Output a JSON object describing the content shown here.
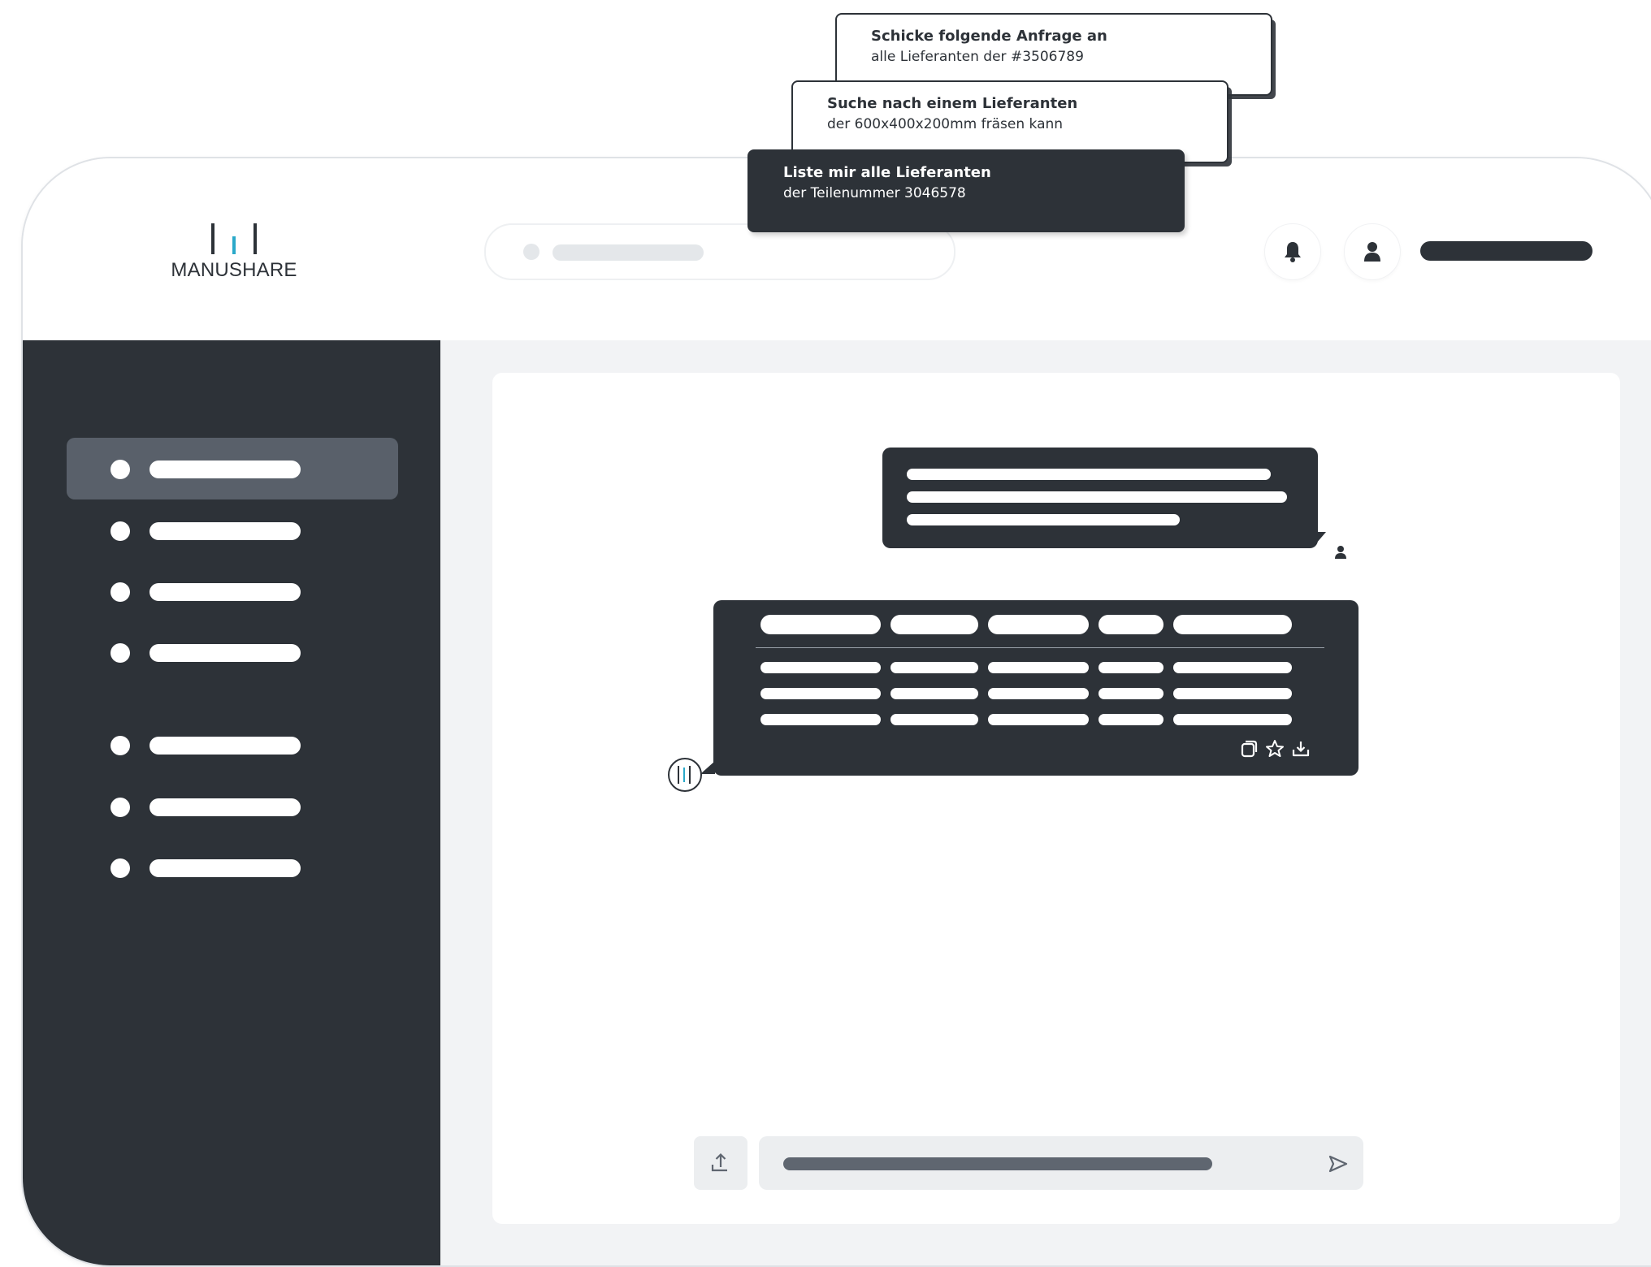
{
  "brand": {
    "name": "MANUSHARE",
    "accent_color": "#2aa9c9",
    "dark_color": "#2d3238"
  },
  "prompts": [
    {
      "title": "Schicke folgende Anfrage an",
      "subtitle": "alle Lieferanten der #3506789"
    },
    {
      "title": "Suche nach einem Lieferanten",
      "subtitle": "der 600x400x200mm fräsen kann"
    },
    {
      "title": "Liste mir alle Lieferanten",
      "subtitle": "der Teilenummer 3046578"
    }
  ],
  "header": {
    "icons": [
      "bell-icon",
      "user-icon"
    ]
  },
  "sidebar": {
    "item_count": 7,
    "active_index": 0
  },
  "chat": {
    "bot_actions": [
      "copy-icon",
      "star-icon",
      "download-icon"
    ],
    "composer_icons": [
      "upload-icon",
      "send-icon"
    ]
  }
}
